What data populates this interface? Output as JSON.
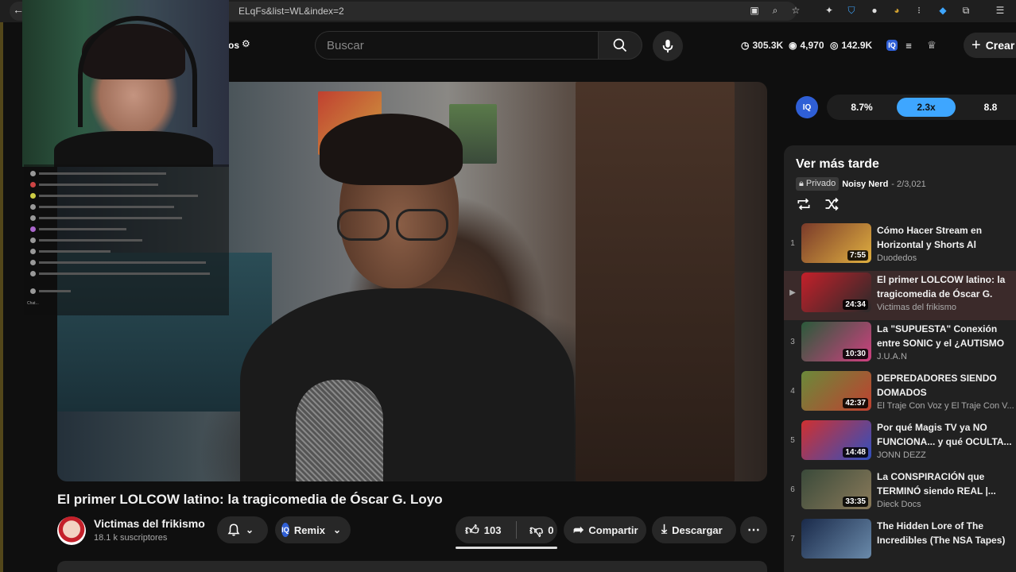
{
  "browser": {
    "url": "ELqFs&list=WL&index=2"
  },
  "header": {
    "filters_label": "os",
    "search_placeholder": "Buscar",
    "stats": [
      {
        "icon": "clock-icon",
        "value": "305.3K"
      },
      {
        "icon": "eye-icon",
        "value": "4,970"
      },
      {
        "icon": "eye-outline-icon",
        "value": "142.9K"
      }
    ],
    "create_label": "Crear"
  },
  "video": {
    "title": "El primer LOLCOW latino: la tragicomedia de Óscar G. Loyo",
    "channel": "Victimas del frikismo",
    "subscribers": "18.1 k suscriptores",
    "remix_label": "Remix",
    "likes": "103",
    "dislikes": "0",
    "share_label": "Compartir",
    "download_label": "Descargar"
  },
  "speed": {
    "iq_label": "IQ",
    "options": [
      "8.7%",
      "2.3x",
      "8.8"
    ],
    "active_index": 1
  },
  "playlist": {
    "title": "Ver más tarde",
    "privacy": "Privado",
    "owner": "Noisy Nerd",
    "position": "- 2/3,021",
    "items": [
      {
        "index": "1",
        "title": "Cómo Hacer Stream en Horizontal y Shorts Al Mismo...",
        "channel": "Duodedos",
        "duration": "7:55",
        "colors": [
          "#7a3a2a",
          "#e0b040"
        ]
      },
      {
        "index": "▶",
        "title": "El primer LOLCOW latino: la tragicomedia de Óscar G. Loyo",
        "channel": "Victimas del frikismo",
        "duration": "24:34",
        "colors": [
          "#c4202a",
          "#2a2a2a"
        ]
      },
      {
        "index": "3",
        "title": "La \"SUPUESTA\" Conexión entre SONIC y el ¿AUTISMO",
        "channel": "J.U.A.N",
        "duration": "10:30",
        "colors": [
          "#2a5a3a",
          "#d04080"
        ]
      },
      {
        "index": "4",
        "title": "DEPREDADORES SIENDO DOMADOS",
        "channel": "El Traje Con Voz y El Traje Con V...",
        "duration": "42:37",
        "colors": [
          "#6a8a3a",
          "#c04030"
        ]
      },
      {
        "index": "5",
        "title": "Por qué Magis TV ya NO FUNCIONA... y qué OCULTA...",
        "channel": "JONN DEZZ",
        "duration": "14:48",
        "colors": [
          "#d03030",
          "#3050c0"
        ]
      },
      {
        "index": "6",
        "title": "La CONSPIRACIÓN que TERMINÓ siendo REAL |...",
        "channel": "Dieck Docs",
        "duration": "33:35",
        "colors": [
          "#3a4a3a",
          "#8a7a5a"
        ]
      },
      {
        "index": "7",
        "title": "The Hidden Lore of The Incredibles (The NSA Tapes)",
        "channel": "",
        "duration": "",
        "colors": [
          "#1a2a4a",
          "#6a8aaa"
        ]
      }
    ]
  },
  "chat": {
    "placeholder": "Chat..."
  }
}
